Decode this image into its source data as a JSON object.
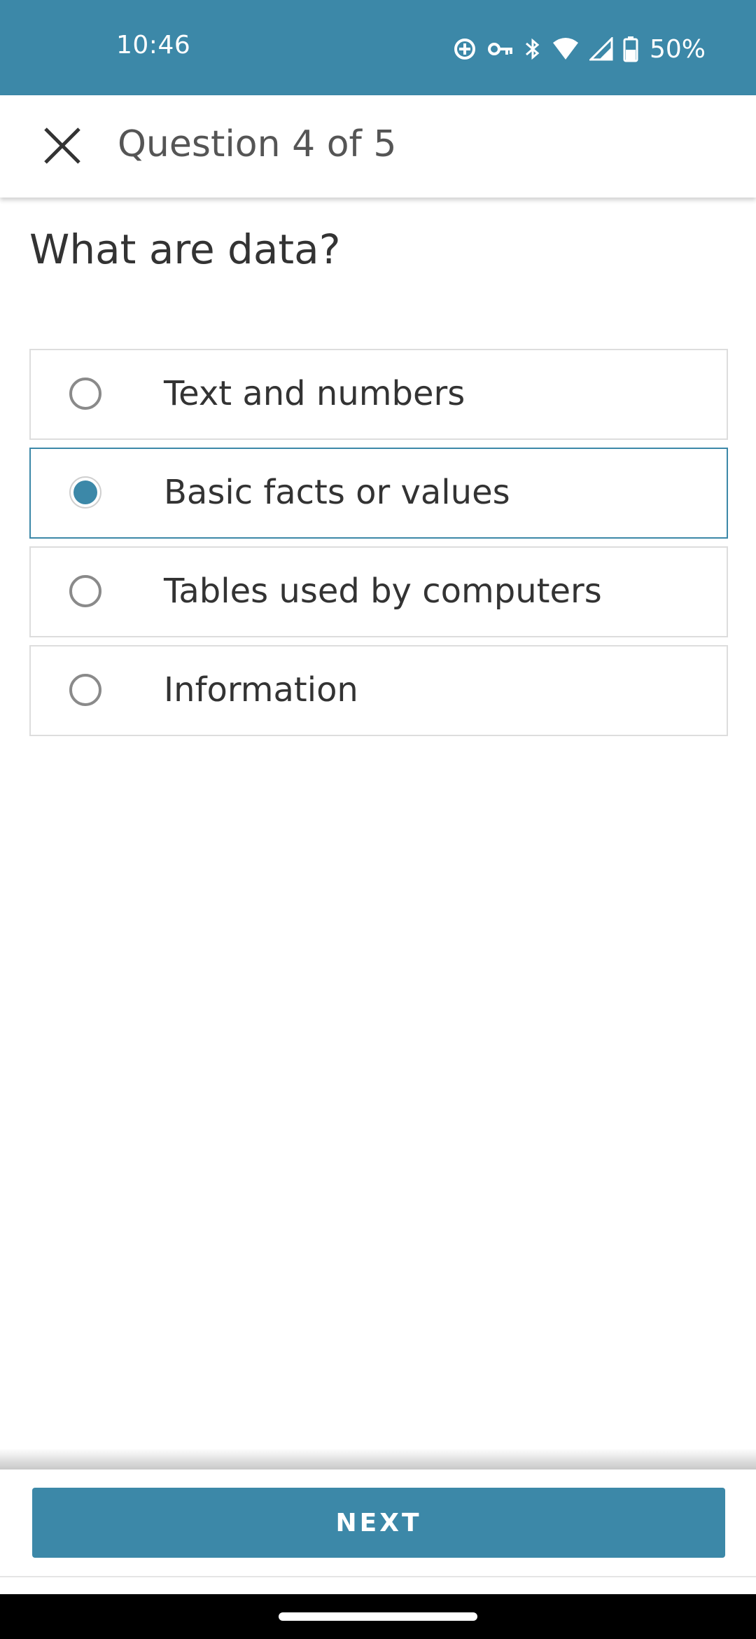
{
  "status_bar": {
    "time": "10:46",
    "battery_percent": "50%",
    "icons": [
      "data-saver-icon",
      "vpn-key-icon",
      "bluetooth-icon",
      "wifi-icon",
      "cell-signal-icon",
      "battery-icon"
    ],
    "background": "#3c88a8"
  },
  "app_bar": {
    "close_icon": "close-icon",
    "title": "Question 4 of 5"
  },
  "question": {
    "text": "What are data?"
  },
  "options": [
    {
      "label": "Text and numbers",
      "selected": false
    },
    {
      "label": "Basic facts or values",
      "selected": true
    },
    {
      "label": "Tables used by computers",
      "selected": false
    },
    {
      "label": "Information",
      "selected": false
    }
  ],
  "footer": {
    "next_label": "NEXT"
  },
  "colors": {
    "accent": "#3c88a8",
    "option_border": "#dddddd",
    "text": "#333333"
  }
}
